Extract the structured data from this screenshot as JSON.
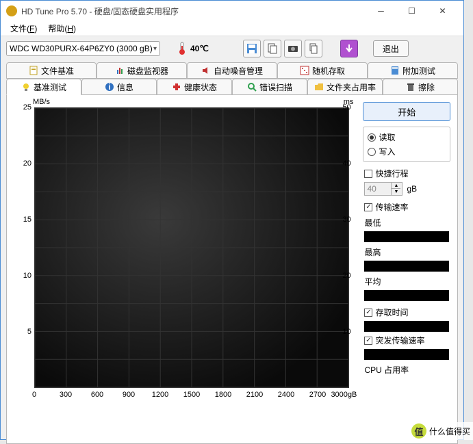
{
  "window": {
    "title": "HD Tune Pro 5.70 - 硬盘/固态硬盘实用程序"
  },
  "menu": {
    "file": "文件",
    "file_u": "F",
    "help": "帮助",
    "help_u": "H"
  },
  "toolbar": {
    "drive": "WDC WD30PURX-64P6ZY0 (3000 gB)",
    "temp": "40℃",
    "exit": "退出"
  },
  "tabs_top": {
    "t0": "文件基准",
    "t1": "磁盘监视器",
    "t2": "自动噪音管理",
    "t3": "随机存取",
    "t4": "附加测试"
  },
  "tabs_bottom": {
    "t0": "基准测试",
    "t1": "信息",
    "t2": "健康状态",
    "t3": "错误扫描",
    "t4": "文件夹占用率",
    "t5": "擦除"
  },
  "chart_data": {
    "type": "line",
    "y_left_label": "MB/s",
    "y_right_label": "ms",
    "y_left_ticks": [
      "25",
      "20",
      "15",
      "10",
      "5"
    ],
    "y_right_ticks": [
      "50",
      "40",
      "30",
      "20",
      "10"
    ],
    "x_ticks": [
      "0",
      "300",
      "600",
      "900",
      "1200",
      "1500",
      "1800",
      "2100",
      "2400",
      "2700",
      "3000gB"
    ],
    "xlim": [
      0,
      3000
    ],
    "ylim_left": [
      0,
      25
    ],
    "ylim_right": [
      0,
      50
    ],
    "series": []
  },
  "side": {
    "start": "开始",
    "read": "读取",
    "write": "写入",
    "shortstroke": "快捷行程",
    "stroke_val": "40",
    "stroke_unit": "gB",
    "transfer": "传输速率",
    "min": "最低",
    "max": "最高",
    "avg": "平均",
    "access": "存取时间",
    "burst": "突发传输速率",
    "cpu": "CPU 占用率"
  },
  "watermark": "什么值得买"
}
